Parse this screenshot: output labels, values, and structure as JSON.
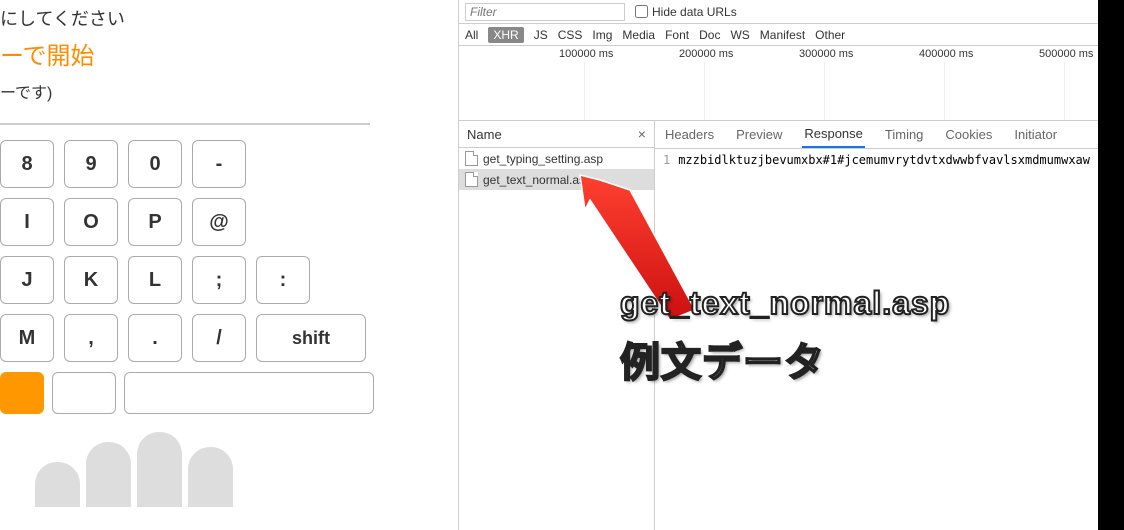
{
  "left": {
    "line1": "にしてください",
    "line2": "ーで開始",
    "line3": "ーです)",
    "rows": {
      "r1": [
        "8",
        "9",
        "0",
        "-"
      ],
      "r2": [
        "I",
        "O",
        "P",
        "@"
      ],
      "r3": [
        "J",
        "K",
        "L",
        ";",
        ":"
      ],
      "r4": [
        "M",
        ",",
        ".",
        "/",
        "shift"
      ]
    }
  },
  "devtools": {
    "filter_placeholder": "Filter",
    "hide_urls_label": "Hide data URLs",
    "types": [
      "All",
      "XHR",
      "JS",
      "CSS",
      "Img",
      "Media",
      "Font",
      "Doc",
      "WS",
      "Manifest",
      "Other"
    ],
    "active_type": "XHR",
    "timeline_ticks": [
      {
        "label": "100000 ms",
        "pos": 100
      },
      {
        "label": "200000 ms",
        "pos": 220
      },
      {
        "label": "300000 ms",
        "pos": 340
      },
      {
        "label": "400000 ms",
        "pos": 460
      },
      {
        "label": "500000 ms",
        "pos": 580
      }
    ],
    "name_header": "Name",
    "requests": [
      {
        "name": "get_typing_setting.asp",
        "selected": false
      },
      {
        "name": "get_text_normal.asp",
        "selected": true
      }
    ],
    "detail_tabs": [
      "Headers",
      "Preview",
      "Response",
      "Timing",
      "Cookies",
      "Initiator"
    ],
    "active_tab": "Response",
    "response_line_no": "1",
    "response_text": "mzzbidlktuzjbevumxbx#1#jcemumvrytdvtxdwwbfvavlsxmdmumwxaw"
  },
  "annotation": {
    "line1": "get_text_normal.asp",
    "line2": "例文データ"
  }
}
